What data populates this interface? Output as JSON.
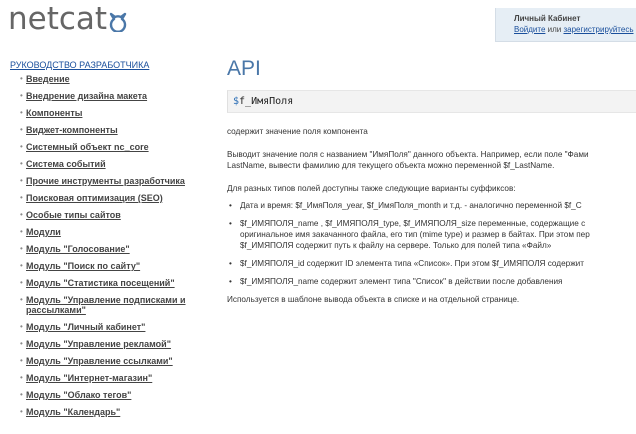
{
  "logo": {
    "text": "netcat",
    "cat_icon": "cat-head-icon"
  },
  "cabinet": {
    "title": "Личный Кабинет",
    "login": "Войдите",
    "or": " или ",
    "register": "зарегистрируйтесь"
  },
  "nav": {
    "heading": "РУКОВОДСТВО РАЗРАБОТЧИКА",
    "items": [
      "Введение",
      "Внедрение дизайна макета",
      "Компоненты",
      "Виджет-компоненты",
      "Системный объект nc_core",
      "Система событий",
      "Прочие инструменты разработчика",
      "Поисковая оптимизация (SEO)",
      "Особые типы сайтов",
      "Модули",
      "Модуль \"Голосование\"",
      "Модуль \"Поиск по сайту\"",
      "Модуль \"Статистика посещений\"",
      "Модуль \"Управление подписками и рассылками\"",
      "Модуль \"Личный кабинет\"",
      "Модуль \"Управление рекламой\"",
      "Модуль \"Управление ссылками\"",
      "Модуль \"Интернет-магазин\"",
      "Модуль \"Облако тегов\"",
      "Модуль \"Календарь\""
    ]
  },
  "main": {
    "title": "API",
    "code_dollar": "$",
    "code_var": "f_ИмяПоля",
    "para1": "содержит значение поля компонента",
    "para2_line1": "Выводит значение поля с названием \"ИмяПоля\" данного объекта. Например, если поле \"Фами",
    "para2_line2": "LastName, вывести фамилию для текущего объекта можно переменной $f_LastName.",
    "para3": "Для разных типов полей доступны также следующие варианты суффиксов:",
    "bullets": [
      [
        "Дата и время: $f_ИмяПоля_year, $f_ИмяПоля_month и т.д. - аналогично переменной $f_C"
      ],
      [
        "$f_ИМЯПОЛЯ_name , $f_ИМЯПОЛЯ_type, $f_ИМЯПОЛЯ_size переменные, содержащие с",
        "оригинальное имя закачанного файла, его тип (mime type) и размер в байтах. При этом пер",
        "$f_ИМЯПОЛЯ содержит путь к файлу на сервере. Только для полей типа «Файл»"
      ],
      [
        "$f_ИМЯПОЛЯ_id содержит ID элемента типа «Список». При этом $f_ИМЯПОЛЯ содержит"
      ],
      [
        "$f_ИМЯПОЛЯ_name содержит элемент типа \"Список\" в действии после добавления"
      ]
    ],
    "para4": "Используется в шаблоне вывода объекта в списке и на отдельной странице."
  }
}
